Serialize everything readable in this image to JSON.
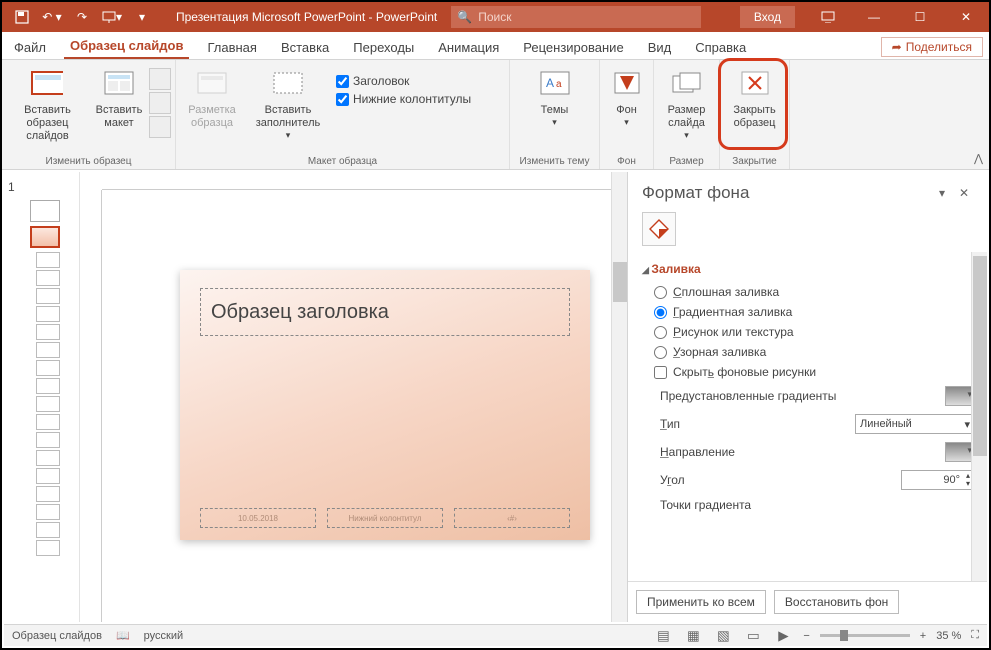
{
  "titlebar": {
    "title": "Презентация Microsoft PowerPoint  -  PowerPoint",
    "search_placeholder": "Поиск",
    "login": "Вход"
  },
  "tabs": {
    "file": "Файл",
    "slide_master": "Образец слайдов",
    "home": "Главная",
    "insert": "Вставка",
    "transitions": "Переходы",
    "animation": "Анимация",
    "review": "Рецензирование",
    "view": "Вид",
    "help": "Справка",
    "share": "Поделиться"
  },
  "ribbon": {
    "g1": {
      "insert_master": "Вставить образец слайдов",
      "insert_layout": "Вставить макет",
      "label": "Изменить образец"
    },
    "g2": {
      "master_layout": "Разметка образца",
      "insert_placeholder": "Вставить заполнитель",
      "chk_title": "Заголовок",
      "chk_footers": "Нижние колонтитулы",
      "label": "Макет образца"
    },
    "g3": {
      "themes": "Темы",
      "label": "Изменить тему"
    },
    "g4": {
      "background": "Фон",
      "label": "Фон"
    },
    "g5": {
      "slide_size": "Размер слайда",
      "label": "Размер"
    },
    "g6": {
      "close_master": "Закрыть образец",
      "label": "Закрытие"
    }
  },
  "slide": {
    "title_placeholder": "Образец заголовка",
    "footer_date": "10.05.2018",
    "footer_center": "Нижний колонтитул",
    "footer_num": "‹#›"
  },
  "pane": {
    "title": "Формат фона",
    "section_fill": "Заливка",
    "radio_solid": "Сплошная заливка",
    "radio_gradient": "Градиентная заливка",
    "radio_picture": "Рисунок или текстура",
    "radio_pattern": "Узорная заливка",
    "chk_hide_bg": "Скрыть фоновые рисунки",
    "preset": "Предустановленные градиенты",
    "type": "Тип",
    "type_value": "Линейный",
    "direction": "Направление",
    "angle": "Угол",
    "angle_value": "90°",
    "stops": "Точки градиента",
    "apply_all": "Применить ко всем",
    "reset": "Восстановить фон"
  },
  "status": {
    "left": "Образец слайдов",
    "lang": "русский",
    "zoom": "35 %"
  },
  "thumbs": {
    "num": "1"
  }
}
